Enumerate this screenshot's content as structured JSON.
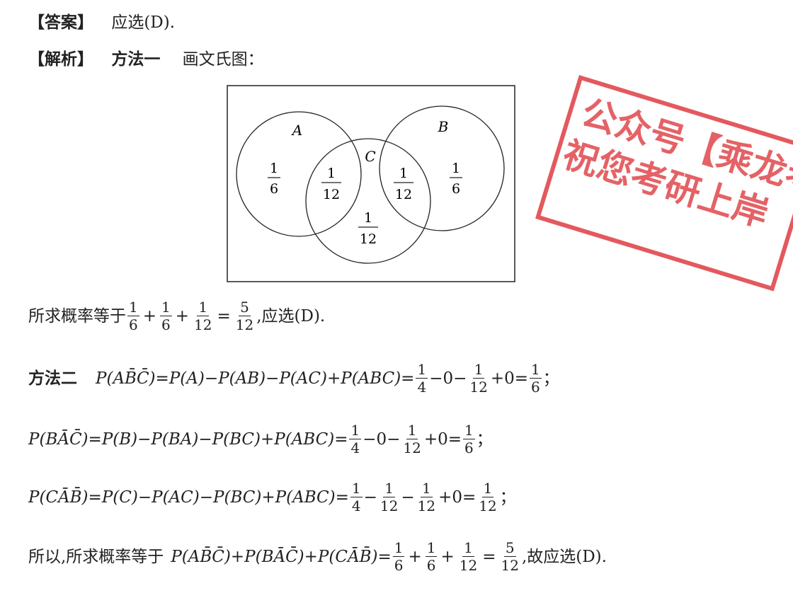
{
  "answer": {
    "tag": "【答案】",
    "text": "应选(D)."
  },
  "analysis": {
    "tag": "【解析】",
    "method1": "方法一",
    "method1_text": "画文氏图："
  },
  "venn": {
    "labels": {
      "a": "A",
      "b": "B",
      "c": "C"
    },
    "regions": {
      "a_only": {
        "num": "1",
        "den": "6"
      },
      "ac": {
        "num": "1",
        "den": "12"
      },
      "bc": {
        "num": "1",
        "den": "12"
      },
      "b_only": {
        "num": "1",
        "den": "6"
      },
      "c_only": {
        "num": "1",
        "den": "12"
      }
    }
  },
  "conclusion1": {
    "prefix": "所求概率等于",
    "terms": [
      {
        "num": "1",
        "den": "6"
      },
      {
        "num": "1",
        "den": "6"
      },
      {
        "num": "1",
        "den": "12"
      }
    ],
    "result": {
      "num": "5",
      "den": "12"
    },
    "suffix": ",应选(D)."
  },
  "method2": {
    "title": "方法二",
    "line1": {
      "lhs": "P(AB̄C̄)",
      "expr": "=P(A)−P(AB)−P(AC)+P(ABC)=",
      "f1": {
        "num": "1",
        "den": "4"
      },
      "t1": "−0−",
      "f2": {
        "num": "1",
        "den": "12"
      },
      "t2": "+0=",
      "f3": {
        "num": "1",
        "den": "6"
      },
      "end": "；"
    },
    "line2": {
      "lhs": "P(BĀC̄)",
      "expr": "=P(B)−P(BA)−P(BC)+P(ABC)=",
      "f1": {
        "num": "1",
        "den": "4"
      },
      "t1": "−0−",
      "f2": {
        "num": "1",
        "den": "12"
      },
      "t2": "+0=",
      "f3": {
        "num": "1",
        "den": "6"
      },
      "end": "；"
    },
    "line3": {
      "lhs": "P(CĀB̄)",
      "expr": "=P(C)−P(AC)−P(BC)+P(ABC)=",
      "f1": {
        "num": "1",
        "den": "4"
      },
      "t1": "−",
      "f2": {
        "num": "1",
        "den": "12"
      },
      "t1b": "−",
      "f2b": {
        "num": "1",
        "den": "12"
      },
      "t2": "+0=",
      "f3": {
        "num": "1",
        "den": "12"
      },
      "end": "；"
    }
  },
  "final": {
    "prefix": "所以,所求概率等于",
    "expr": "P(AB̄C̄)+P(BĀC̄)+P(CĀB̄)=",
    "terms": [
      {
        "num": "1",
        "den": "6"
      },
      {
        "num": "1",
        "den": "6"
      },
      {
        "num": "1",
        "den": "12"
      }
    ],
    "result": {
      "num": "5",
      "den": "12"
    },
    "suffix": ",故应选(D)."
  },
  "stamp": {
    "line1": "公众号【乘龙考",
    "line2": "祝您考研上岸",
    "color": "#e0474c"
  }
}
